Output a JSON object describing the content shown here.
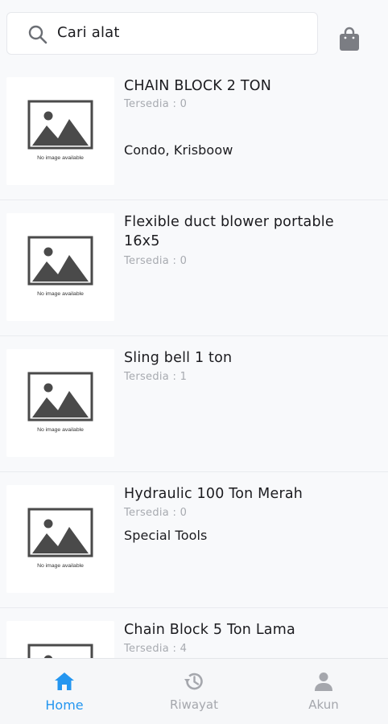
{
  "search": {
    "text": "Cari alat"
  },
  "thumbnail": {
    "caption": "No image available"
  },
  "items": [
    {
      "title": "CHAIN BLOCK 2 TON",
      "stock": "Tersedia : 0",
      "brand": "Condo, Krisboow"
    },
    {
      "title": "Flexible duct blower portable 16x5",
      "stock": "Tersedia : 0",
      "brand": ""
    },
    {
      "title": "Sling bell 1 ton",
      "stock": "Tersedia : 1",
      "brand": ""
    },
    {
      "title": "Hydraulic 100 Ton Merah",
      "stock": "Tersedia : 0",
      "brand": "Special Tools"
    },
    {
      "title": "Chain Block 5 Ton Lama",
      "stock": "Tersedia : 4",
      "brand": ""
    }
  ],
  "nav": {
    "home": {
      "label": "Home",
      "icon": "home-icon",
      "active": true
    },
    "riwayat": {
      "label": "Riwayat",
      "icon": "history-icon",
      "active": false
    },
    "akun": {
      "label": "Akun",
      "icon": "person-icon",
      "active": false
    }
  },
  "colors": {
    "accent": "#2496f0",
    "inactive": "#a5a7ad",
    "icon_gray": "#7b7d83",
    "stock_text": "#a7aab0"
  }
}
